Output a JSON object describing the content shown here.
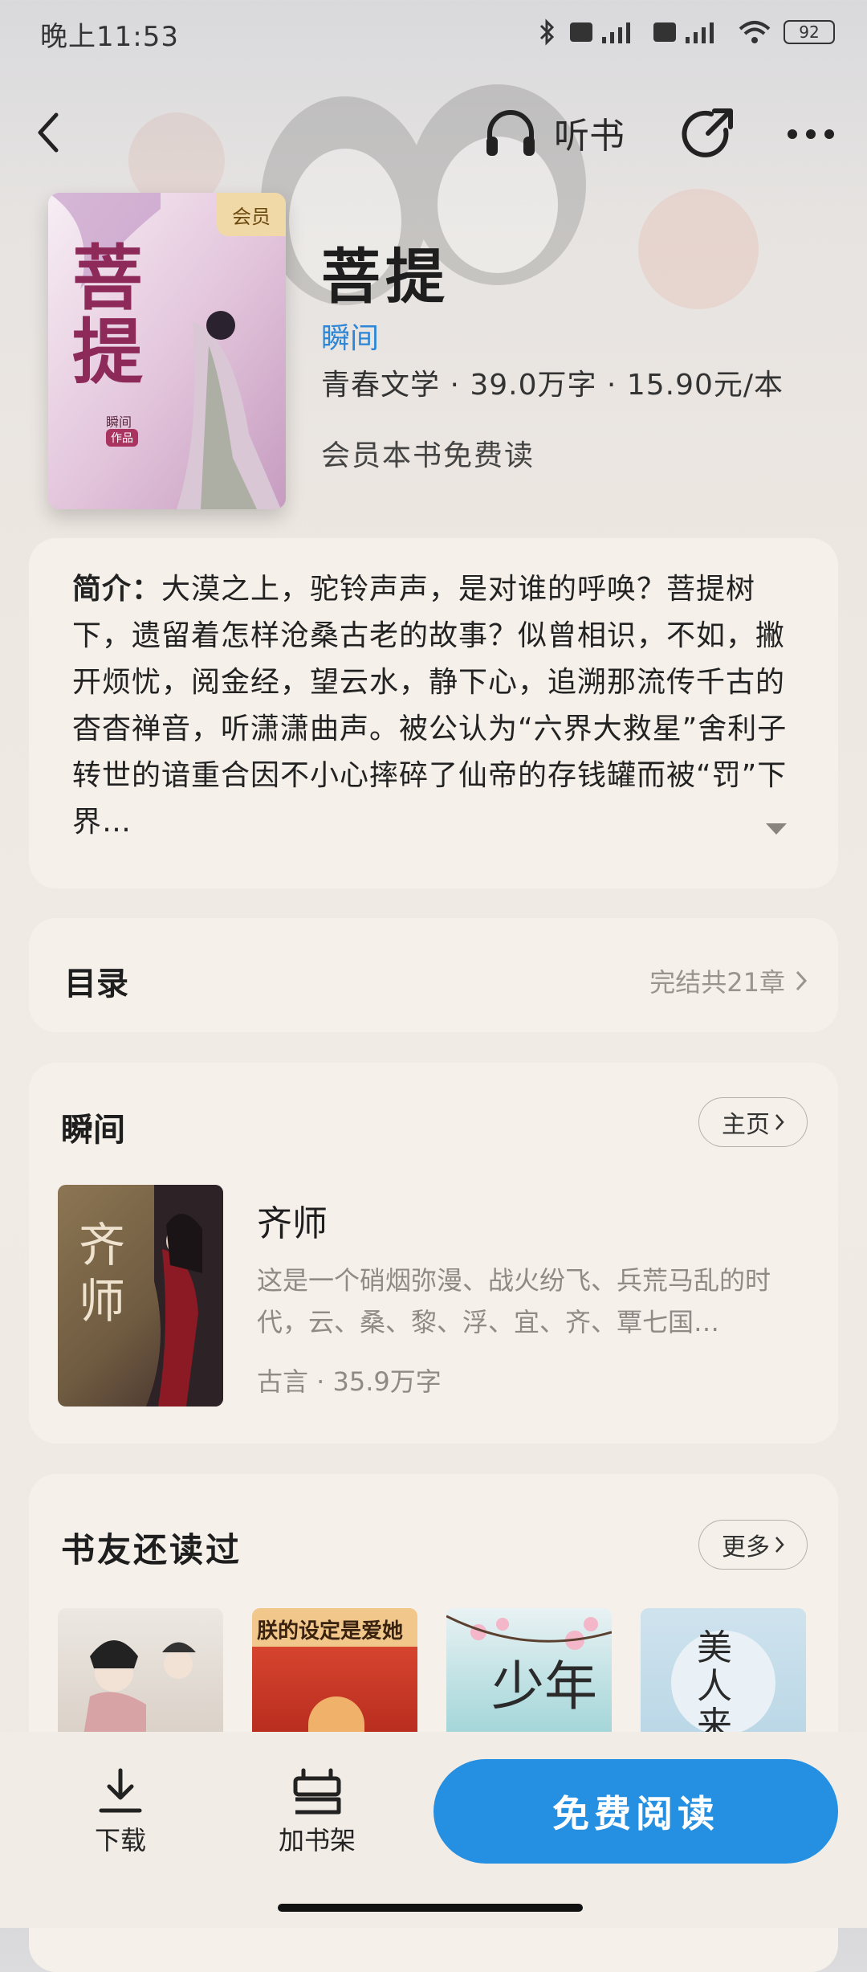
{
  "status_bar": {
    "time": "晚上11:53",
    "battery": "92"
  },
  "nav": {
    "listen_label": "听书"
  },
  "book": {
    "vip_badge": "会员",
    "title": "菩提",
    "author": "瞬间",
    "meta": "青春文学 · 39.0万字 · 15.90元/本",
    "free_note": "会员本书免费读",
    "cover_title": "菩提",
    "cover_author": "瞬间",
    "cover_tag": "作品"
  },
  "intro": {
    "label": "简介：",
    "text": "大漠之上，驼铃声声，是对谁的呼唤？菩提树下，遗留着怎样沧桑古老的故事？似曾相识，不如，撇开烦忧，阅金经，望云水，静下心，追溯那流传千古的杳杳禅音，听潇潇曲声。被公认为“六界大救星”舍利子转世的谙重合因不小心摔碎了仙帝的存钱罐而被“罚”下界…"
  },
  "toc": {
    "title": "目录",
    "info": "完结共21章"
  },
  "author_section": {
    "name": "瞬间",
    "home_label": "主页",
    "book": {
      "title": "齐师",
      "cover_text": "齐师",
      "desc": "这是一个硝烟弥漫、战火纷飞、兵荒马乱的时代，云、桑、黎、浮、宜、齐、覃七国…",
      "meta": "古言 · 35.9万字"
    }
  },
  "friends": {
    "title": "书友还读过",
    "more_label": "更多",
    "covers": [
      {
        "text": ""
      },
      {
        "text": "朕的设定是爱她"
      },
      {
        "text": "少年"
      },
      {
        "text": "美人来"
      }
    ]
  },
  "bottom": {
    "download_label": "下载",
    "shelf_label": "加书架",
    "read_label": "免费阅读"
  },
  "colors": {
    "accent": "#2590e2",
    "author_link": "#2c86d8",
    "vip": "#f0d9a7"
  }
}
